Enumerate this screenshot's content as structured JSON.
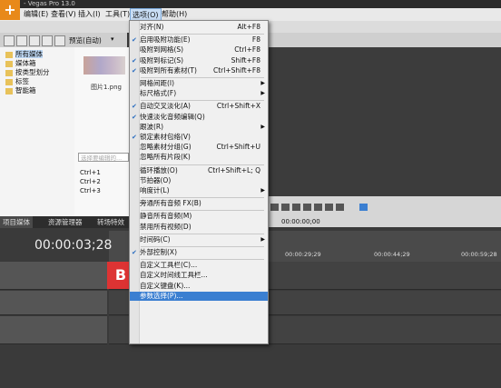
{
  "window": {
    "title": "- Vegas Pro 13.0"
  },
  "menubar": {
    "items": [
      "编辑(E)",
      "查看(V)",
      "插入(I)",
      "工具(T)",
      "选项(O)",
      "帮助(H)"
    ]
  },
  "explorer": {
    "view_label": "预览(自动)",
    "folders": [
      "所有媒体",
      "媒体箱",
      "按类型划分",
      "标签",
      "智能箱"
    ],
    "media_file": "图片1.png",
    "filter_placeholder": "选择要编辑的...",
    "shortcuts": [
      "Ctrl+1",
      "Ctrl+2",
      "Ctrl+3"
    ],
    "tabs": [
      "项目媒体",
      "资源管理器",
      "转场特效"
    ]
  },
  "timeline": {
    "timecode": "00:00:03;28",
    "ruler": [
      "00:00:29;29",
      "00:00:44;29",
      "00:00:59;28"
    ],
    "transport_time": "00:00:00;00",
    "clip_text": "B"
  },
  "options_menu": {
    "items": [
      {
        "label": "对齐(N)",
        "key": "Alt+F8",
        "check": false,
        "sub": false,
        "hl": false
      },
      {
        "sep": true
      },
      {
        "label": "启用吸附功能(E)",
        "key": "F8",
        "check": true,
        "sub": false,
        "hl": false
      },
      {
        "label": "吸附到网格(S)",
        "key": "Ctrl+F8",
        "check": false,
        "sub": false,
        "hl": false
      },
      {
        "label": "吸附到标记(S)",
        "key": "Shift+F8",
        "check": true,
        "sub": false,
        "hl": false
      },
      {
        "label": "吸附到所有素材(T)",
        "key": "Ctrl+Shift+F8",
        "check": true,
        "sub": false,
        "hl": false
      },
      {
        "sep": true
      },
      {
        "label": "网格间距(I)",
        "key": "",
        "check": false,
        "sub": true,
        "hl": false
      },
      {
        "label": "标尺格式(F)",
        "key": "",
        "check": false,
        "sub": true,
        "hl": false
      },
      {
        "sep": true
      },
      {
        "label": "自动交叉淡化(A)",
        "key": "Ctrl+Shift+X",
        "check": true,
        "sub": false,
        "hl": false
      },
      {
        "label": "快速淡化音频编辑(Q)",
        "key": "",
        "check": true,
        "sub": false,
        "hl": false
      },
      {
        "label": "跟波(R)",
        "key": "",
        "check": false,
        "sub": true,
        "hl": false
      },
      {
        "label": "锁定素材包络(V)",
        "key": "",
        "check": true,
        "sub": false,
        "hl": false
      },
      {
        "label": "忽略素材分组(G)",
        "key": "Ctrl+Shift+U",
        "check": false,
        "sub": false,
        "hl": false
      },
      {
        "label": "忽略所有片段(K)",
        "key": "",
        "check": false,
        "sub": false,
        "hl": false
      },
      {
        "sep": true
      },
      {
        "label": "循环播放(O)",
        "key": "Ctrl+Shift+L; Q",
        "check": false,
        "sub": false,
        "hl": false
      },
      {
        "label": "节拍器(O)",
        "key": "",
        "check": false,
        "sub": false,
        "hl": false
      },
      {
        "label": "响度计(L)",
        "key": "",
        "check": false,
        "sub": true,
        "hl": false
      },
      {
        "sep": true
      },
      {
        "label": "旁通所有音频 FX(B)",
        "key": "",
        "check": false,
        "sub": false,
        "hl": false
      },
      {
        "sep": true
      },
      {
        "label": "静音所有音频(M)",
        "key": "",
        "check": false,
        "sub": false,
        "hl": false
      },
      {
        "label": "禁用所有视频(D)",
        "key": "",
        "check": false,
        "sub": false,
        "hl": false
      },
      {
        "sep": true
      },
      {
        "label": "时间码(C)",
        "key": "",
        "check": false,
        "sub": true,
        "hl": false
      },
      {
        "sep": true
      },
      {
        "label": "外部控制(X)",
        "key": "",
        "check": true,
        "sub": false,
        "hl": false
      },
      {
        "sep": true
      },
      {
        "label": "自定义工具栏(C)...",
        "key": "",
        "check": false,
        "sub": false,
        "hl": false
      },
      {
        "label": "自定义时间线工具栏...",
        "key": "",
        "check": false,
        "sub": false,
        "hl": false
      },
      {
        "label": "自定义键盘(K)...",
        "key": "",
        "check": false,
        "sub": false,
        "hl": false
      },
      {
        "label": "参数选择(P)...",
        "key": "",
        "check": false,
        "sub": false,
        "hl": true
      }
    ]
  }
}
